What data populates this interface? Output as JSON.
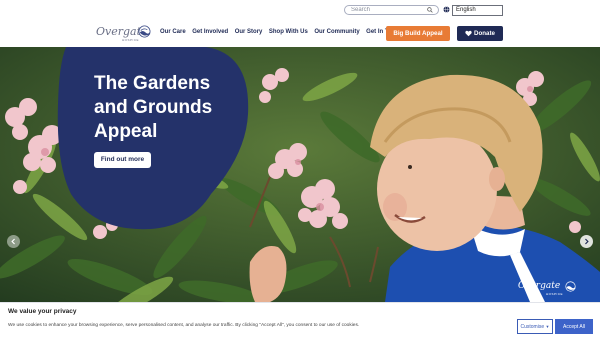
{
  "colors": {
    "navy": "#1f2a55",
    "orange": "#e87b35",
    "accept_blue": "#3d63c9",
    "uniform_blue": "#1d4fb0"
  },
  "topbar": {
    "search_placeholder": "Search",
    "search_icon": "search-icon",
    "globe_icon": "globe-icon",
    "language": "English"
  },
  "nav": {
    "logo_text": "Overgate",
    "logo_sub": "HOSPICE",
    "items": [
      {
        "label": "Our Care"
      },
      {
        "label": "Get Involved"
      },
      {
        "label": "Our Story"
      },
      {
        "label": "Shop With Us"
      },
      {
        "label": "Our Community"
      },
      {
        "label": "Get In Touch"
      }
    ],
    "build_button": "Big Build Appeal",
    "donate_button": "Donate",
    "donate_icon": "heart-icon"
  },
  "hero": {
    "title": "The Gardens and Grounds Appeal",
    "cta": "Find out more",
    "prev_icon": "chevron-left-icon",
    "next_icon": "chevron-right-icon",
    "uniform_logo_text": "Overgate",
    "uniform_logo_sub": "HOSPICE"
  },
  "cookie": {
    "title": "We value your privacy",
    "text": "We use cookies to enhance your browsing experience, serve personalised content, and analyse our traffic. By clicking \"Accept All\", you consent to our use of cookies.",
    "customise": "Customise",
    "accept": "Accept All"
  }
}
